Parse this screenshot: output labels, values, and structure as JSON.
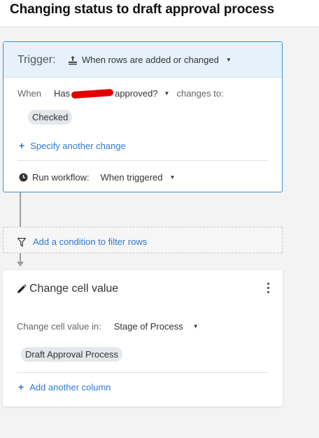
{
  "header": {
    "title": "Changing status to draft approval process"
  },
  "trigger": {
    "label": "Trigger:",
    "event_icon": "rows-change-icon",
    "event": "When rows are added or changed",
    "when_label": "When",
    "column_prefix": "Has",
    "column_suffix": "approved?",
    "changes_to": "changes to:",
    "value": "Checked",
    "specify_link": "Specify another change",
    "run_label": "Run workflow:",
    "run_value": "When triggered"
  },
  "filter": {
    "label": "Add a condition to filter rows"
  },
  "action": {
    "title": "Change cell value",
    "field_label": "Change cell value in:",
    "field_value": "Stage of Process",
    "value": "Draft Approval Process",
    "add_link": "Add another column"
  },
  "colors": {
    "accent": "#2e7ad1",
    "trigger_bg": "#e6f1fb",
    "border": "#3d8fd6"
  }
}
